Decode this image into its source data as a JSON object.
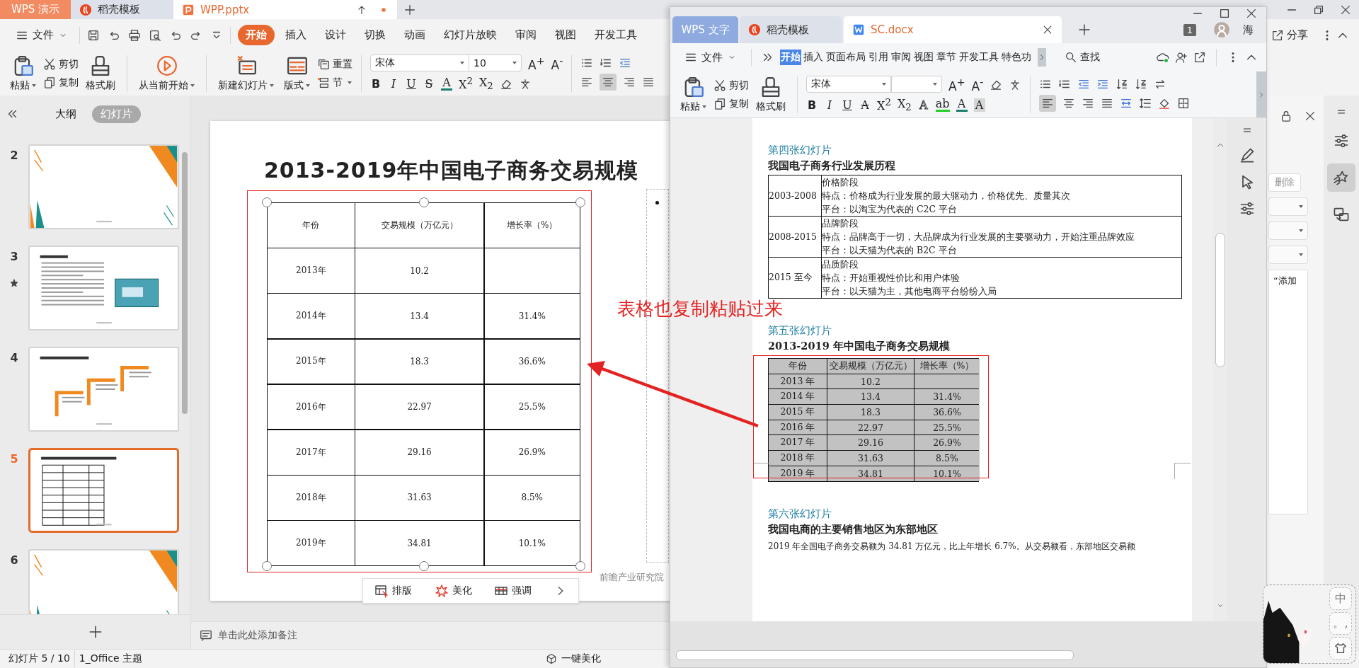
{
  "presentation_window": {
    "tabs": [
      {
        "label": "WPS 演示",
        "kind": "app",
        "selected": false
      },
      {
        "label": "稻壳模板",
        "kind": "template",
        "selected": false
      },
      {
        "label": "WPP.pptx",
        "kind": "doc",
        "selected": true
      }
    ],
    "file_menu": "文件",
    "menu_tabs": [
      {
        "label": "开始",
        "selected": true
      },
      {
        "label": "插入",
        "selected": false
      },
      {
        "label": "设计",
        "selected": false
      },
      {
        "label": "切换",
        "selected": false
      },
      {
        "label": "动画",
        "selected": false
      },
      {
        "label": "幻灯片放映",
        "selected": false
      },
      {
        "label": "审阅",
        "selected": false
      },
      {
        "label": "视图",
        "selected": false
      },
      {
        "label": "开发工具",
        "selected": false
      }
    ],
    "share": "分享",
    "ribbon": {
      "paste": "粘贴",
      "cut": "剪切",
      "copy": "复制",
      "format_painter": "格式刷",
      "play_from_current": "从当前开始",
      "new_slide": "新建幻灯片",
      "layout": "版式",
      "reset": "重置",
      "section": "节",
      "font": "宋体",
      "font_size": "10"
    },
    "size_buttons": [
      "A$^{+}$",
      "A$^{-}$"
    ],
    "format_buttons": [
      {
        "label": "B",
        "kind": "bold"
      },
      {
        "label": "I",
        "kind": "italic"
      },
      {
        "label": "U",
        "kind": "underline"
      },
      {
        "label": "S",
        "kind": "strike"
      },
      {
        "label": "A",
        "kind": "color"
      },
      {
        "label": "X$^{2}$",
        "kind": "superscript"
      },
      {
        "label": "X$_{2}$",
        "kind": "subscript"
      }
    ],
    "panel_tabs": [
      {
        "label": "大纲",
        "selected": false
      },
      {
        "label": "幻灯片",
        "selected": true
      }
    ],
    "slides": [
      {
        "number": "2",
        "kind": "cover",
        "animated": false,
        "selected": false
      },
      {
        "number": "3",
        "kind": "text",
        "animated": true,
        "selected": false
      },
      {
        "number": "4",
        "kind": "timeline",
        "animated": false,
        "selected": false
      },
      {
        "number": "5",
        "kind": "table",
        "animated": false,
        "selected": true
      },
      {
        "number": "6",
        "kind": "cover",
        "animated": false,
        "selected": false
      }
    ],
    "slide": {
      "title": "2013-2019年中国电子商务交易规模",
      "table": {
        "columns": [
          "年份",
          "交易规模（万亿元）",
          "增长率（%）"
        ],
        "rows": [
          [
            "2013年",
            "10.2"
          ],
          [
            "2014年",
            "13.4",
            "31.4%"
          ],
          [
            "2015年",
            "18.3",
            "36.6%"
          ],
          [
            "2016年",
            "22.97",
            "25.5%"
          ],
          [
            "2017年",
            "29.16",
            "26.9%"
          ],
          [
            "2018年",
            "31.63",
            "8.5%"
          ],
          [
            "2019年",
            "34.81",
            "10.1%"
          ]
        ]
      },
      "source": "前瞻产业研究院"
    },
    "float_toolbar": [
      {
        "label": "排版",
        "kind": "layout"
      },
      {
        "label": "美化",
        "kind": "beautify"
      },
      {
        "label": "强调",
        "kind": "emphasis"
      }
    ],
    "notes_placeholder": "单击此处添加备注",
    "status_bar": {
      "slide_counter": "幻灯片 5 / 10",
      "theme": "1_Office 主题",
      "beautify": "一键美化"
    },
    "task_pane": {
      "delete_button": "删除",
      "text_box": "“添加"
    },
    "sidebar": [
      {
        "kind": "properties",
        "selected": false
      },
      {
        "kind": "animation",
        "selected": true
      },
      {
        "kind": "switch",
        "selected": false
      }
    ]
  },
  "document_window": {
    "tabs": [
      {
        "label": "WPS 文字",
        "kind": "app",
        "selected": false
      },
      {
        "label": "稻壳模板",
        "kind": "template",
        "selected": false
      },
      {
        "label": "SC.docx",
        "kind": "doc",
        "selected": true
      }
    ],
    "page_badge": "1",
    "user_name": "海",
    "file_menu": "文件",
    "menu_tabs": [
      {
        "label": "开始",
        "selected": true
      },
      {
        "label": "插入",
        "selected": false
      },
      {
        "label": "页面布局",
        "selected": false
      },
      {
        "label": "引用",
        "selected": false
      },
      {
        "label": "审阅",
        "selected": false
      },
      {
        "label": "视图",
        "selected": false
      },
      {
        "label": "章节",
        "selected": false
      },
      {
        "label": "开发工具",
        "selected": false
      },
      {
        "label": "特色功",
        "selected": false
      }
    ],
    "search": "查找",
    "ribbon": {
      "paste": "粘贴",
      "cut": "剪切",
      "copy": "复制",
      "format_painter": "格式刷",
      "font": "宋体"
    },
    "size_buttons": [
      "A$^{+}$",
      "A$^{-}$"
    ],
    "format_buttons": [
      {
        "label": "B",
        "kind": "bold"
      },
      {
        "label": "I",
        "kind": "italic"
      },
      {
        "label": "U",
        "kind": "underline"
      },
      {
        "label": "A",
        "kind": "strike"
      },
      {
        "label": "X$^{2}$",
        "kind": "superscript"
      },
      {
        "label": "X$_{2}$",
        "kind": "subscript"
      },
      {
        "label": "A",
        "kind": "outline"
      },
      {
        "label": "ab",
        "kind": "highlight"
      },
      {
        "label": "A",
        "kind": "color"
      },
      {
        "label": "A",
        "kind": "shade"
      }
    ],
    "sections": [
      {
        "heading": "第四张幻灯片",
        "title": "我国电子商务行业发展历程",
        "kind": "stage_table",
        "rows": [
          {
            "period": "2003-2008",
            "lines": [
              "价格阶段",
              "特点：价格成为行业发展的最大驱动力，价格优先、质量其次",
              "平台：以淘宝为代表的 C2C 平台"
            ]
          },
          {
            "period": "2008-2015",
            "lines": [
              "品牌阶段",
              "特点：品牌高于一切，大品牌成为行业发展的主要驱动力，开始注重品牌效应",
              "平台：以天猫为代表的 B2C 平台"
            ]
          },
          {
            "period": "2015 至今",
            "lines": [
              "品质阶段",
              "特点：开始重视性价比和用户体验",
              "平台：以天猫为主，其他电商平台纷纷入局"
            ]
          }
        ]
      },
      {
        "heading": "第五张幻灯片",
        "title": "2013-2019 年中国电子商务交易规模",
        "kind": "data_table",
        "columns": [
          "年份",
          "交易规模（万亿元）",
          "增长率（%）"
        ],
        "rows": [
          [
            "2013 年",
            "10.2"
          ],
          [
            "2014 年",
            "13.4",
            "31.4%"
          ],
          [
            "2015 年",
            "18.3",
            "36.6%"
          ],
          [
            "2016 年",
            "22.97",
            "25.5%"
          ],
          [
            "2017 年",
            "29.16",
            "26.9%"
          ],
          [
            "2018 年",
            "31.63",
            "8.5%"
          ],
          [
            "2019 年",
            "34.81",
            "10.1%"
          ]
        ]
      },
      {
        "heading": "第六张幻灯片",
        "title": "我国电商的主要销售地区为东部地区",
        "kind": "paragraph",
        "text": "2019 年全国电子商务交易额为 34.81 万亿元，比上年增长 6.7%。从交易额看，东部地区交易额"
      }
    ]
  },
  "annotation": {
    "text": "表格也复制粘贴过来"
  },
  "ime_widget": {
    "mode": "中",
    "punctuation": "。,"
  }
}
